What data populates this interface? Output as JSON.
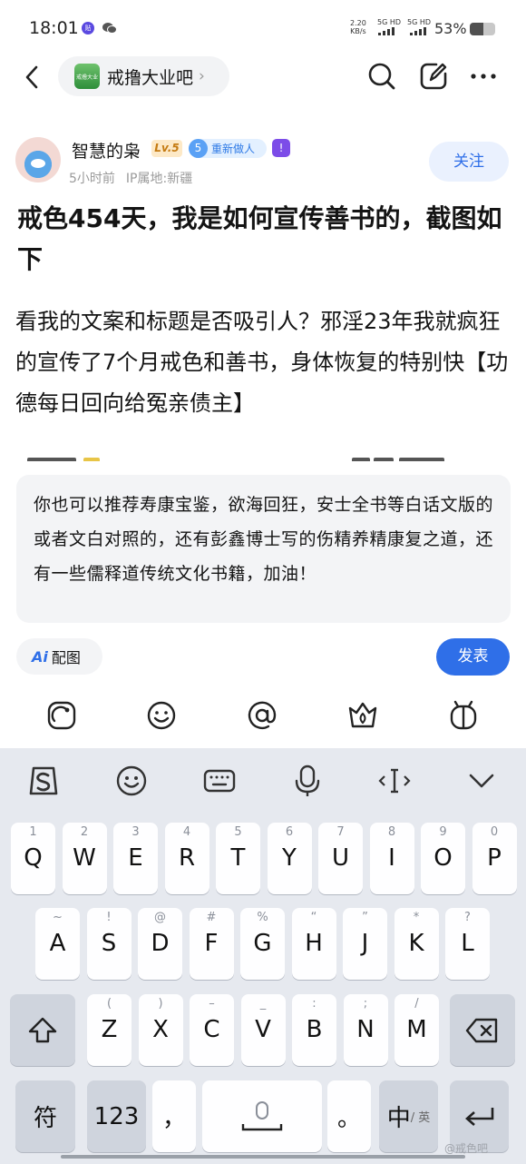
{
  "status_bar": {
    "time": "18:01",
    "notif_badge": "贴",
    "net_speed_value": "2.20",
    "net_speed_unit": "KB/s",
    "sim1": "5G HD",
    "sim2": "5G HD",
    "battery_text": "53%",
    "battery_level": 0.53
  },
  "nav": {
    "forum_name": "戒撸大业吧",
    "forum_logo_text": "戒撸大业",
    "chevron": "›"
  },
  "author": {
    "name": "智慧的枭",
    "level": "Lv.5",
    "honor_num": "5",
    "honor_label": "重新做人",
    "vip_glyph": "!",
    "time_ago": "5小时前",
    "ip_location": "IP属地:新疆",
    "follow_label": "关注"
  },
  "post": {
    "title": "戒色454天，我是如何宣传善书的，截图如下",
    "body": "看我的文案和标题是否吸引人？邪淫23年我就疯狂的宣传了7个月戒色和善书，身体恢复的特别快【功德每日回向给冤亲债主】"
  },
  "composer": {
    "reply_text": "你也可以推荐寿康宝鉴，欲海回狂，安士全书等白话文版的或者文白对照的，还有彭鑫博士写的伤精养精康复之道，还有一些儒释道传统文化书籍，加油！",
    "ai_icon_text": "Ai",
    "ai_label": "配图",
    "send_label": "发表",
    "tools": [
      "sticker-icon",
      "emoji-icon",
      "at-icon",
      "gift-icon",
      "magic-icon"
    ]
  },
  "keyboard": {
    "row1": [
      {
        "hint": "1",
        "key": "Q"
      },
      {
        "hint": "2",
        "key": "W"
      },
      {
        "hint": "3",
        "key": "E"
      },
      {
        "hint": "4",
        "key": "R"
      },
      {
        "hint": "5",
        "key": "T"
      },
      {
        "hint": "6",
        "key": "Y"
      },
      {
        "hint": "7",
        "key": "U"
      },
      {
        "hint": "8",
        "key": "I"
      },
      {
        "hint": "9",
        "key": "O"
      },
      {
        "hint": "0",
        "key": "P"
      }
    ],
    "row2": [
      {
        "hint": "~",
        "key": "A"
      },
      {
        "hint": "!",
        "key": "S"
      },
      {
        "hint": "@",
        "key": "D"
      },
      {
        "hint": "#",
        "key": "F"
      },
      {
        "hint": "%",
        "key": "G"
      },
      {
        "hint": "“",
        "key": "H"
      },
      {
        "hint": "”",
        "key": "J"
      },
      {
        "hint": "*",
        "key": "K"
      },
      {
        "hint": "?",
        "key": "L"
      }
    ],
    "row3": [
      {
        "hint": "(",
        "key": "Z"
      },
      {
        "hint": ")",
        "key": "X"
      },
      {
        "hint": "–",
        "key": "C"
      },
      {
        "hint": "_",
        "key": "V"
      },
      {
        "hint": ":",
        "key": "B"
      },
      {
        "hint": ";",
        "key": "N"
      },
      {
        "hint": "/",
        "key": "M"
      }
    ],
    "symbol_key": "符",
    "number_key": "123",
    "comma_key": "，",
    "period_key": "。",
    "lang_key_main": "中",
    "lang_key_sub": "/ 英"
  },
  "watermark": "@戒色吧"
}
